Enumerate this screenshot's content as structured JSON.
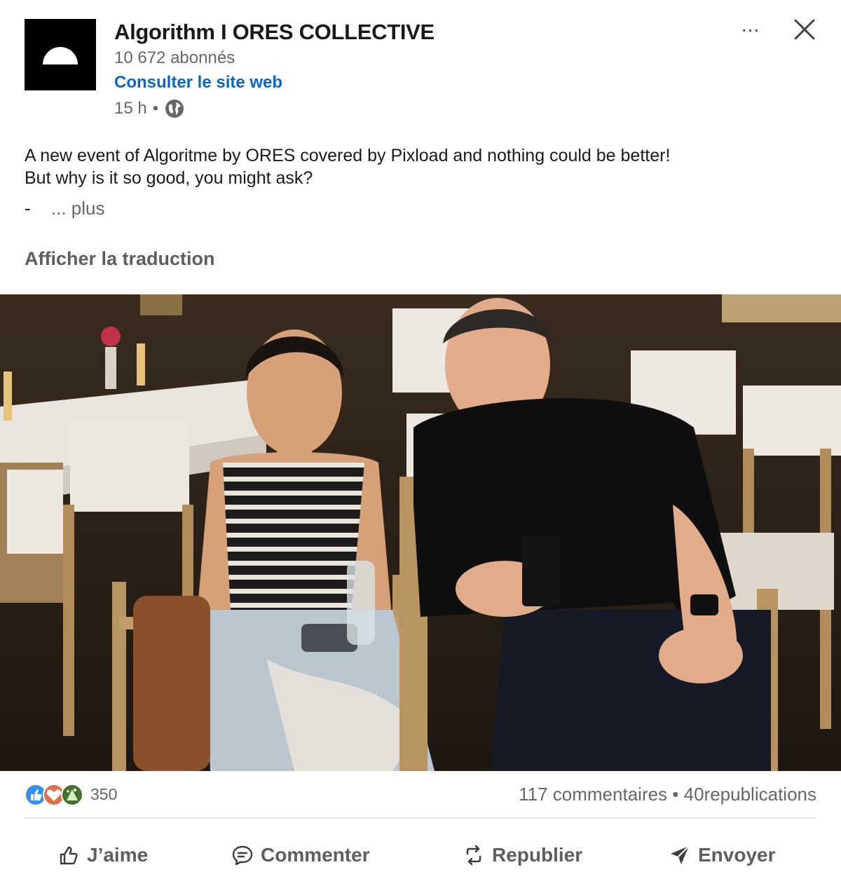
{
  "post": {
    "author": {
      "name": "Algorithm I ORES COLLECTIVE",
      "followers": "10 672 abonnés",
      "website_link": "Consulter le site web"
    },
    "meta": {
      "time": "15 h",
      "separator": "•",
      "visibility_icon": "globe-icon"
    },
    "text": {
      "line1": "A new event of Algoritme by ORES covered by Pixload and nothing could be better!",
      "line2": "But why is it so good, you might ask?",
      "bullet": "-",
      "more": "... plus"
    },
    "translate_link": "Afficher la traduction",
    "image": {
      "subject": "photo-two-people-seated-at-event"
    },
    "social": {
      "reaction_icons": [
        "like-reaction-icon",
        "love-reaction-icon",
        "celebrate-reaction-icon"
      ],
      "reaction_count": "350",
      "comments": "117 commentaires",
      "separator": "•",
      "reposts": "40republications"
    },
    "actions": [
      {
        "label": "J’aime",
        "icon": "thumbs-up-icon"
      },
      {
        "label": "Commenter",
        "icon": "comment-icon"
      },
      {
        "label": "Republier",
        "icon": "repost-icon"
      },
      {
        "label": "Envoyer",
        "icon": "send-icon"
      }
    ],
    "header_controls": {
      "more": "...",
      "close_icon": "close-icon"
    }
  },
  "colors": {
    "link_blue": "#0a66c2",
    "muted_text": "#666666",
    "body_text": "#1a1a1a",
    "like_blue": "#378fe9",
    "love_red": "#df704d",
    "celebrate_green": "#44712e"
  }
}
